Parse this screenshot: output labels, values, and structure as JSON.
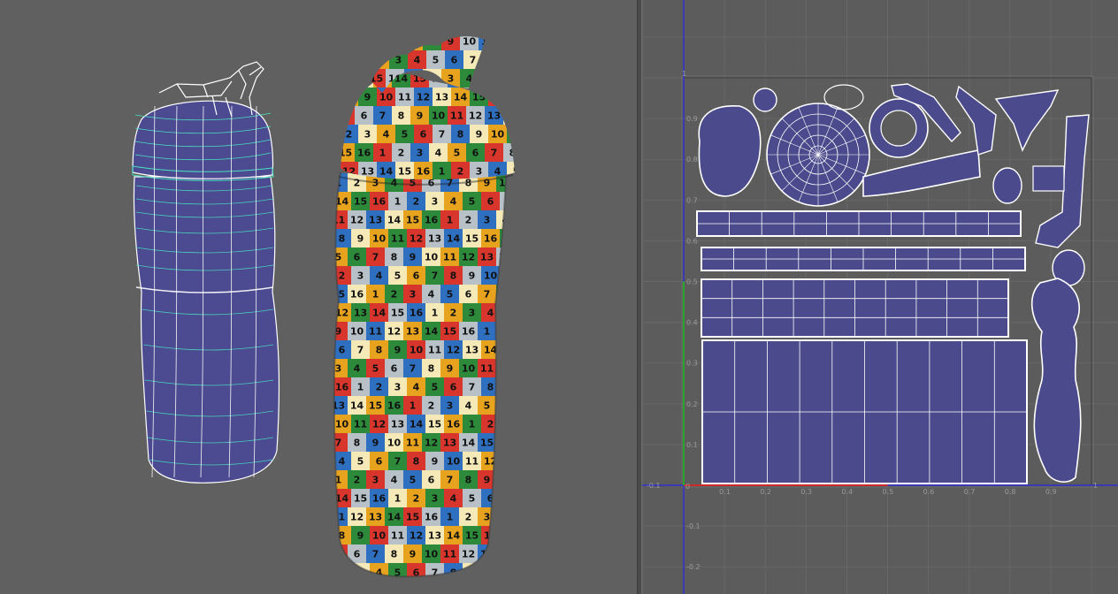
{
  "viewport": {
    "background_color": "#606060",
    "wire_color": "#ffffff",
    "selection_color": "#49e0c0",
    "mesh_color": "#4c4a90"
  },
  "checker": {
    "colors": [
      "#2f6fc0",
      "#f5e9b8",
      "#e8a31e",
      "#2c8a3a",
      "#d8362c",
      "#b7c1c7"
    ]
  },
  "uv_editor": {
    "background_color": "#5c5c5c",
    "shell_color": "#4a4a8c",
    "axis_v_color": "#2f2fcf",
    "axis_u_color": "#cc2a2a",
    "axis_green_color": "#2aa62a",
    "u_ticks": [
      "0.1",
      "0.2",
      "0.3",
      "0.4",
      "0.5",
      "0.6",
      "0.7",
      "0.8",
      "0.9"
    ],
    "v_ticks": [
      "0.9",
      "0.8",
      "0.7",
      "0.6",
      "0.5",
      "0.4",
      "0.3",
      "0.2",
      "0.1"
    ],
    "neg_v_ticks": [
      "-0.1",
      "-0.2"
    ],
    "origin_label": "0",
    "u_one_label": "1",
    "v_one_label": "1",
    "neg_u_label": "-0.1"
  }
}
